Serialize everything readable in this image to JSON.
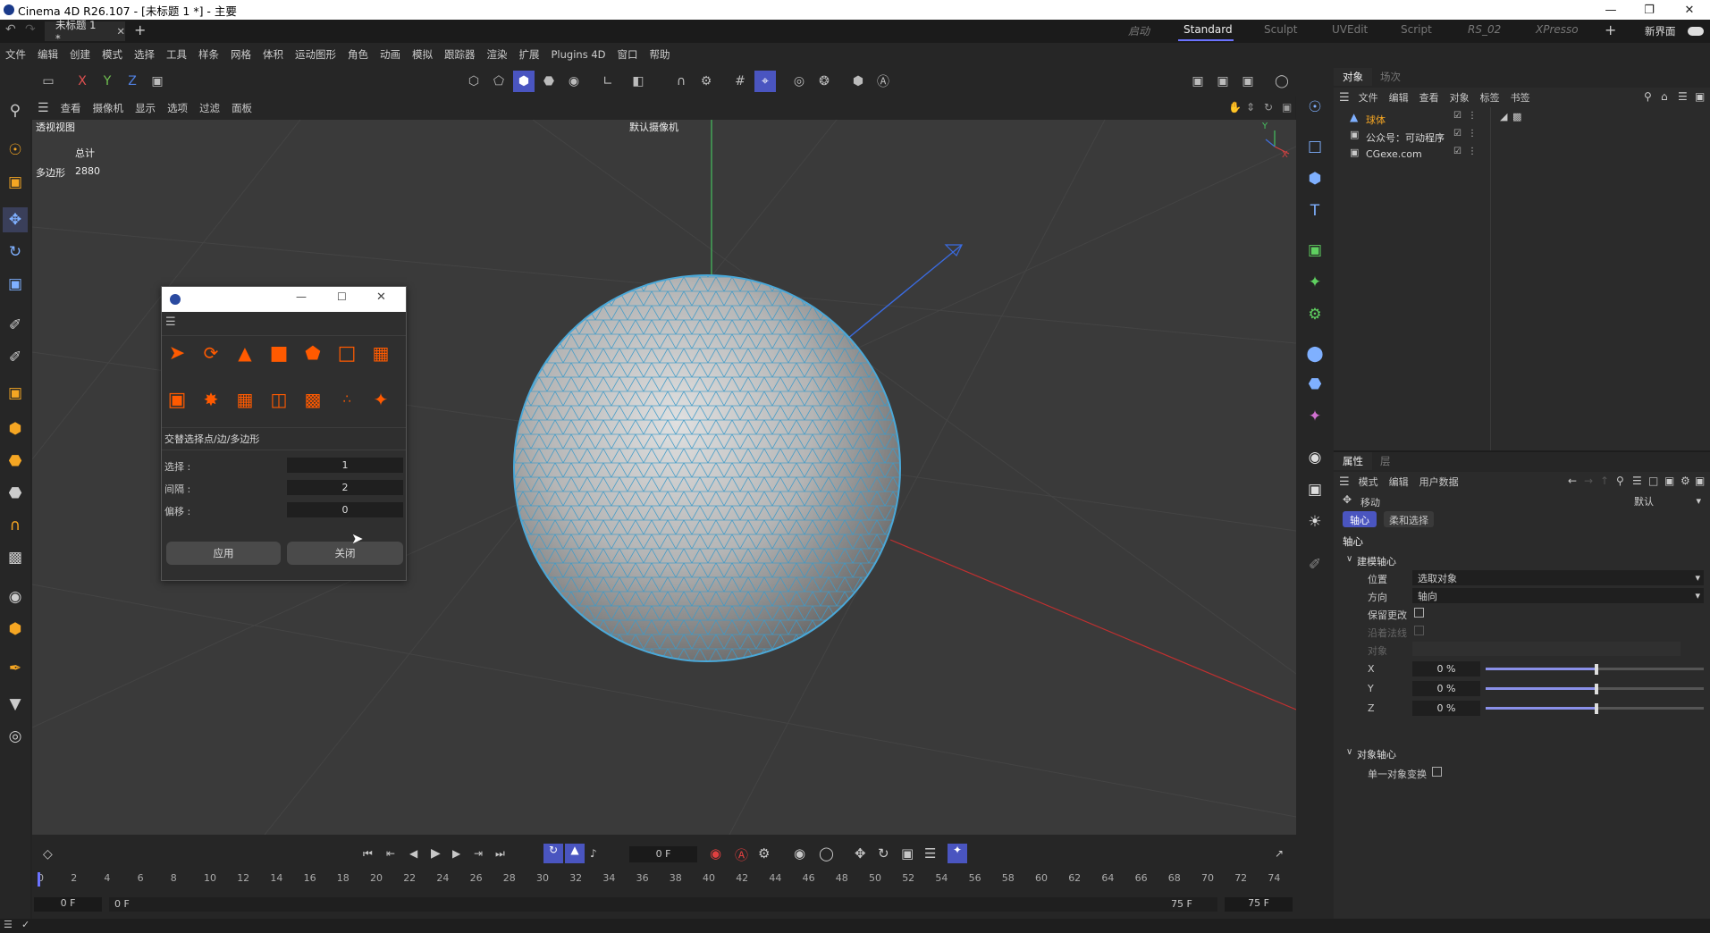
{
  "app": {
    "window_title": "Cinema 4D R26.107 - [未标题 1 *] - 主要",
    "doc_tab": "未标题 1 *",
    "layouts": [
      "启动",
      "Standard",
      "Sculpt",
      "UVEdit",
      "Script",
      "RS_02",
      "XPresso"
    ],
    "active_layout": "Standard",
    "new_layout": "新界面"
  },
  "menubar": [
    "文件",
    "编辑",
    "创建",
    "模式",
    "选择",
    "工具",
    "样条",
    "网格",
    "体积",
    "运动图形",
    "角色",
    "动画",
    "模拟",
    "跟踪器",
    "渲染",
    "扩展",
    "Plugins 4D",
    "窗口",
    "帮助"
  ],
  "toolbar": {
    "axes": [
      "X",
      "Y",
      "Z"
    ],
    "icons": [
      "undo-icon",
      "redo-icon",
      "lock-icon",
      "x-axis-icon",
      "y-axis-icon",
      "z-axis-icon",
      "coord-system-icon",
      "points-mode-icon",
      "edges-mode-icon",
      "polygons-mode-icon",
      "model-mode-icon",
      "texture-mode-icon",
      "workplane-icon",
      "axis-mode-icon",
      "magnet-icon",
      "gear-icon",
      "grid-icon",
      "snap-icon",
      "render-icon",
      "render-settings-icon",
      "camera-icon",
      "a-icon",
      "clapper-icon",
      "render-view-icon",
      "render-queue-icon",
      "interactive-render-icon"
    ]
  },
  "viewport_menu": [
    "查看",
    "摄像机",
    "显示",
    "选项",
    "过滤",
    "面板"
  ],
  "viewport": {
    "name": "透视视图",
    "camera": "默认摄像机",
    "stats_header": "总计",
    "stats_label": "多边形",
    "stats_value": "2880",
    "axis_labels": [
      "Y",
      "X"
    ]
  },
  "object_manager": {
    "tabs": [
      "对象",
      "场次"
    ],
    "menu": [
      "文件",
      "编辑",
      "查看",
      "对象",
      "标签",
      "书签"
    ],
    "objects": [
      {
        "name": "球体",
        "color": "#f5a623"
      },
      {
        "name": "公众号：可动程序",
        "color": "#d8d8d8"
      },
      {
        "name": "CGexe.com",
        "color": "#d8d8d8"
      }
    ]
  },
  "attributes": {
    "tabs": [
      "属性",
      "层"
    ],
    "menu": [
      "模式",
      "编辑",
      "用户数据"
    ],
    "tool_name": "移动",
    "preset": "默认",
    "subtabs": [
      "轴心",
      "柔和选择"
    ],
    "section": "轴心",
    "group1": "建模轴心",
    "position_label": "位置",
    "position_value": "选取对象",
    "direction_label": "方向",
    "direction_value": "轴向",
    "keep_label": "保留更改",
    "normal_label": "沿着法线",
    "object_label": "对象",
    "xyz": [
      {
        "label": "X",
        "value": "0 %",
        "level": 0.5
      },
      {
        "label": "Y",
        "value": "0 %",
        "level": 0.5
      },
      {
        "label": "Z",
        "value": "0 %",
        "level": 0.5
      }
    ],
    "group2": "对象轴心",
    "single_label": "单一对象变换"
  },
  "dialog": {
    "section_title": "交替选择点/边/多边形",
    "fields": [
      {
        "label": "选择 :",
        "value": "1"
      },
      {
        "label": "间隔 :",
        "value": "2"
      },
      {
        "label": "偏移 :",
        "value": "0"
      }
    ],
    "apply": "应用",
    "close": "关闭",
    "accent": "#ff5a00"
  },
  "timeline": {
    "current_frame": "0 F",
    "start_frame": "0 F",
    "range_start": "0 F",
    "range_end": "75 F",
    "end_frame": "75 F",
    "ticks": [
      "0",
      "2",
      "4",
      "6",
      "8",
      "10",
      "12",
      "14",
      "16",
      "18",
      "20",
      "22",
      "24",
      "26",
      "28",
      "30",
      "32",
      "34",
      "36",
      "38",
      "40",
      "42",
      "44",
      "46",
      "48",
      "50",
      "52",
      "54",
      "56",
      "58",
      "60",
      "62",
      "64",
      "66",
      "68",
      "70",
      "72",
      "74"
    ]
  }
}
